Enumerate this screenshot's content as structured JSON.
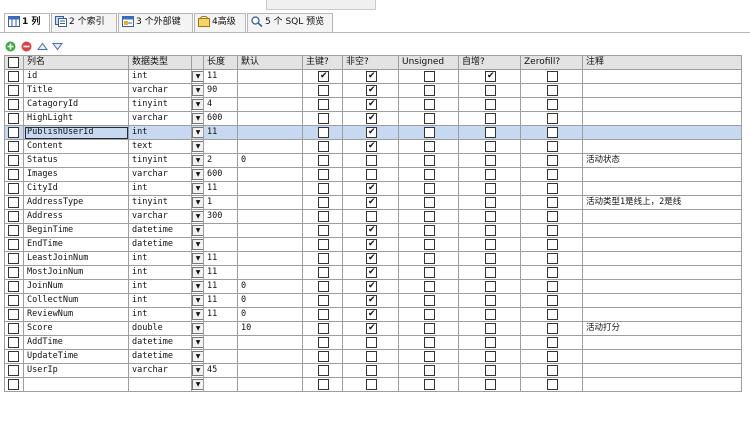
{
  "tabs": [
    {
      "label": "1 列",
      "icon": "columns-icon",
      "active": true
    },
    {
      "label": "2 个索引",
      "icon": "index-icon",
      "active": false
    },
    {
      "label": "3 个外部键",
      "icon": "foreign-key-icon",
      "active": false
    },
    {
      "label": "4高级",
      "icon": "advanced-icon",
      "active": false
    },
    {
      "label": "5 个 SQL 预览",
      "icon": "sql-preview-icon",
      "active": false
    }
  ],
  "toolbar": {
    "buttons": [
      "add-column-icon",
      "remove-column-icon",
      "move-up-icon",
      "move-down-icon"
    ]
  },
  "columns": [
    "列名",
    "数据类型",
    "长度",
    "默认",
    "主键?",
    "非空?",
    "Unsigned",
    "自增?",
    "Zerofill?",
    "注释"
  ],
  "rows": [
    {
      "name": "id",
      "type": "int",
      "length": "11",
      "default": "",
      "pk": true,
      "notnull": true,
      "unsigned": false,
      "autoinc": true,
      "zerofill": false,
      "comment": ""
    },
    {
      "name": "Title",
      "type": "varchar",
      "length": "90",
      "default": "",
      "pk": false,
      "notnull": true,
      "unsigned": false,
      "autoinc": false,
      "zerofill": false,
      "comment": ""
    },
    {
      "name": "CatagoryId",
      "type": "tinyint",
      "length": "4",
      "default": "",
      "pk": false,
      "notnull": true,
      "unsigned": false,
      "autoinc": false,
      "zerofill": false,
      "comment": ""
    },
    {
      "name": "HighLight",
      "type": "varchar",
      "length": "600",
      "default": "",
      "pk": false,
      "notnull": true,
      "unsigned": false,
      "autoinc": false,
      "zerofill": false,
      "comment": ""
    },
    {
      "name": "PublishUserId",
      "type": "int",
      "length": "11",
      "default": "",
      "pk": false,
      "notnull": true,
      "unsigned": false,
      "autoinc": false,
      "zerofill": false,
      "comment": "",
      "selected": true
    },
    {
      "name": "Content",
      "type": "text",
      "length": "",
      "default": "",
      "pk": false,
      "notnull": true,
      "unsigned": false,
      "autoinc": false,
      "zerofill": false,
      "comment": ""
    },
    {
      "name": "Status",
      "type": "tinyint",
      "length": "2",
      "default": "0",
      "pk": false,
      "notnull": false,
      "unsigned": false,
      "autoinc": false,
      "zerofill": false,
      "comment": "活动状态"
    },
    {
      "name": "Images",
      "type": "varchar",
      "length": "600",
      "default": "",
      "pk": false,
      "notnull": false,
      "unsigned": false,
      "autoinc": false,
      "zerofill": false,
      "comment": ""
    },
    {
      "name": "CityId",
      "type": "int",
      "length": "11",
      "default": "",
      "pk": false,
      "notnull": true,
      "unsigned": false,
      "autoinc": false,
      "zerofill": false,
      "comment": ""
    },
    {
      "name": "AddressType",
      "type": "tinyint",
      "length": "1",
      "default": "",
      "pk": false,
      "notnull": true,
      "unsigned": false,
      "autoinc": false,
      "zerofill": false,
      "comment": "活动类型1是线上，2是线"
    },
    {
      "name": "Address",
      "type": "varchar",
      "length": "300",
      "default": "",
      "pk": false,
      "notnull": false,
      "unsigned": false,
      "autoinc": false,
      "zerofill": false,
      "comment": ""
    },
    {
      "name": "BeginTime",
      "type": "datetime",
      "length": "",
      "default": "",
      "pk": false,
      "notnull": true,
      "unsigned": false,
      "autoinc": false,
      "zerofill": false,
      "comment": ""
    },
    {
      "name": "EndTime",
      "type": "datetime",
      "length": "",
      "default": "",
      "pk": false,
      "notnull": true,
      "unsigned": false,
      "autoinc": false,
      "zerofill": false,
      "comment": ""
    },
    {
      "name": "LeastJoinNum",
      "type": "int",
      "length": "11",
      "default": "",
      "pk": false,
      "notnull": true,
      "unsigned": false,
      "autoinc": false,
      "zerofill": false,
      "comment": ""
    },
    {
      "name": "MostJoinNum",
      "type": "int",
      "length": "11",
      "default": "",
      "pk": false,
      "notnull": true,
      "unsigned": false,
      "autoinc": false,
      "zerofill": false,
      "comment": ""
    },
    {
      "name": "JoinNum",
      "type": "int",
      "length": "11",
      "default": "0",
      "pk": false,
      "notnull": true,
      "unsigned": false,
      "autoinc": false,
      "zerofill": false,
      "comment": ""
    },
    {
      "name": "CollectNum",
      "type": "int",
      "length": "11",
      "default": "0",
      "pk": false,
      "notnull": true,
      "unsigned": false,
      "autoinc": false,
      "zerofill": false,
      "comment": ""
    },
    {
      "name": "ReviewNum",
      "type": "int",
      "length": "11",
      "default": "0",
      "pk": false,
      "notnull": true,
      "unsigned": false,
      "autoinc": false,
      "zerofill": false,
      "comment": ""
    },
    {
      "name": "Score",
      "type": "double",
      "length": "",
      "default": "10",
      "pk": false,
      "notnull": true,
      "unsigned": false,
      "autoinc": false,
      "zerofill": false,
      "comment": "活动打分"
    },
    {
      "name": "AddTime",
      "type": "datetime",
      "length": "",
      "default": "",
      "pk": false,
      "notnull": false,
      "unsigned": false,
      "autoinc": false,
      "zerofill": false,
      "comment": ""
    },
    {
      "name": "UpdateTime",
      "type": "datetime",
      "length": "",
      "default": "",
      "pk": false,
      "notnull": false,
      "unsigned": false,
      "autoinc": false,
      "zerofill": false,
      "comment": ""
    },
    {
      "name": "UserIp",
      "type": "varchar",
      "length": "45",
      "default": "",
      "pk": false,
      "notnull": false,
      "unsigned": false,
      "autoinc": false,
      "zerofill": false,
      "comment": ""
    },
    {
      "name": "",
      "type": "",
      "length": "",
      "default": "",
      "pk": false,
      "notnull": false,
      "unsigned": false,
      "autoinc": false,
      "zerofill": false,
      "comment": ""
    }
  ]
}
